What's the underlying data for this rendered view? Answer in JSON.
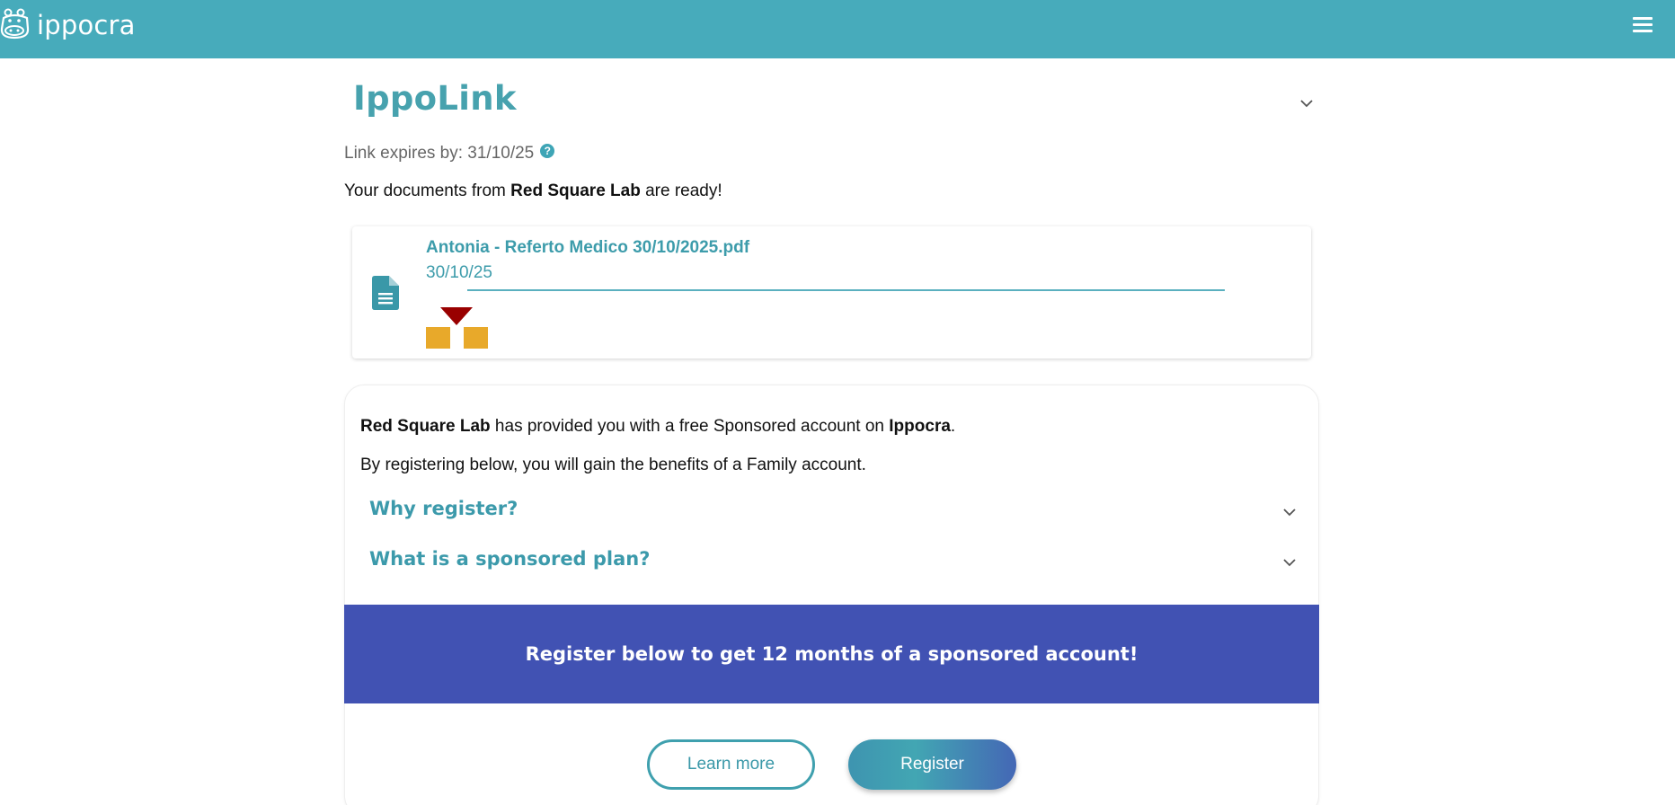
{
  "header": {
    "brand": "ippocra",
    "logo_icon": "hippo-logo-icon",
    "menu_icon": "hamburger-menu-icon",
    "background_color": "#47abbb"
  },
  "page": {
    "title": "IppoLink",
    "expires_label": "Link expires by: 31/10/25",
    "help_icon": "question-circle-icon",
    "ready_prefix": "Your documents from ",
    "ready_lab": "Red Square Lab",
    "ready_suffix": " are ready!"
  },
  "document": {
    "name": "Antonia - Referto Medico 30/10/2025.pdf",
    "date": "30/10/25",
    "icon": "file-document-icon",
    "lab_logo": "red-square-lab-logo"
  },
  "sponsorship": {
    "lab": "Red Square Lab",
    "text_mid": " has provided you with a free Sponsored account on ",
    "platform": "Ippocra",
    "text_end": ".",
    "benefits": "By registering below, you will gain the benefits of a Family account.",
    "faq": [
      {
        "label": "Why register?"
      },
      {
        "label": "What is a sponsored plan?"
      }
    ]
  },
  "banner": {
    "text": "Register below to get 12 months of a sponsored account!",
    "color": "#4152b3"
  },
  "actions": {
    "learn_more": "Learn more",
    "register": "Register"
  },
  "colors": {
    "accent": "#47a2ae",
    "lab_red": "#990000",
    "lab_yellow": "#e8a92a"
  }
}
